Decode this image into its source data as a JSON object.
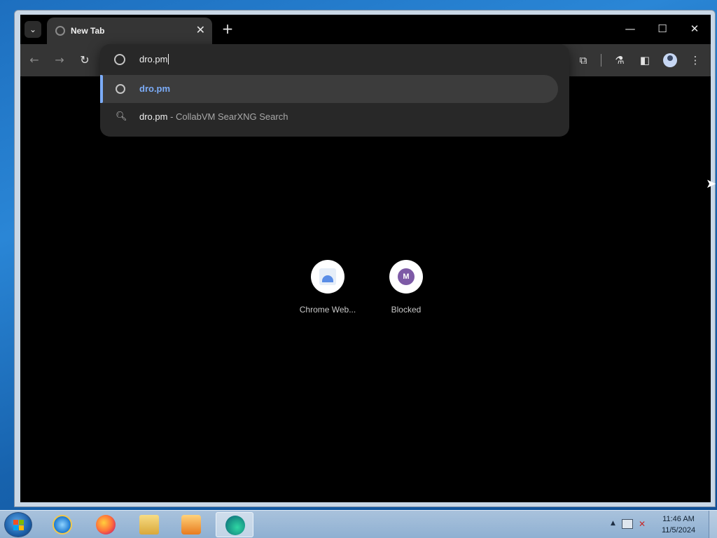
{
  "browser": {
    "tab": {
      "title": "New Tab",
      "close_glyph": "✕"
    },
    "new_tab_glyph": "+",
    "window_controls": {
      "minimize": "—",
      "maximize": "☐",
      "close": "✕"
    },
    "toolbar": {
      "back_glyph": "←",
      "forward_glyph": "→",
      "reload_glyph": "↻",
      "extensions_glyph": "⧉",
      "labs_glyph": "⚗",
      "sidepanel_glyph": "◧",
      "menu_glyph": "⋮"
    },
    "omnibox": {
      "value": "dro.pm",
      "suggestions": [
        {
          "text": "dro.pm",
          "subtext": ""
        },
        {
          "text": "dro.pm",
          "subtext": " - CollabVM SearXNG Search"
        }
      ]
    },
    "shortcuts": [
      {
        "label": "Chrome Web..."
      },
      {
        "label": "Blocked",
        "letter": "M"
      }
    ],
    "tab_search_glyph": "⌄"
  },
  "taskbar": {
    "apps": [
      "internet-explorer",
      "firefox",
      "windows-explorer",
      "windows-media-player",
      "microsoft-edge"
    ],
    "clock": {
      "time": "11:46 AM",
      "date": "11/5/2024"
    },
    "tray_up_glyph": "▲"
  },
  "colors": {
    "accent": "#7cacf8",
    "toolbar": "#353535",
    "taskbar": "#a9c2dc"
  }
}
